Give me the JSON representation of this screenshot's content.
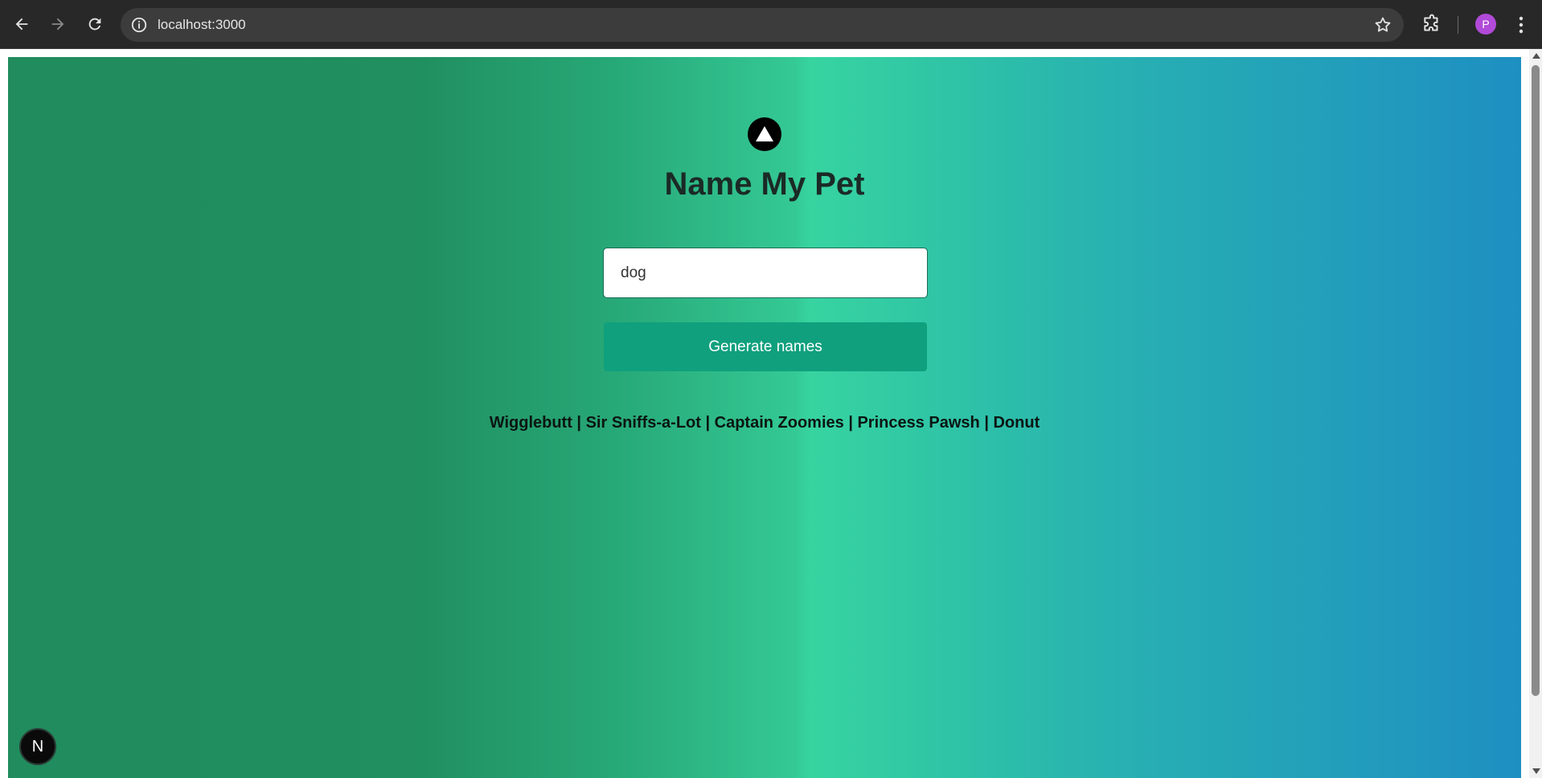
{
  "browser": {
    "url": "localhost:3000",
    "profile_initial": "P",
    "profile_color": "#b14ad8"
  },
  "page": {
    "title": "Name My Pet",
    "input_value": "dog",
    "button_label": "Generate names",
    "result_text": "Wigglebutt | Sir Sniffs-a-Lot | Captain Zoomies | Princess Pawsh | Donut",
    "nextjs_badge": "N",
    "button_color": "#10a07e"
  },
  "icons": {
    "back": "back-arrow-icon",
    "forward": "forward-arrow-icon",
    "reload": "reload-icon",
    "site_info": "site-info-icon",
    "bookmark": "bookmark-star-icon",
    "extensions": "puzzle-piece-icon",
    "menu": "kebab-menu-icon",
    "logo": "triangle-logo-icon"
  }
}
